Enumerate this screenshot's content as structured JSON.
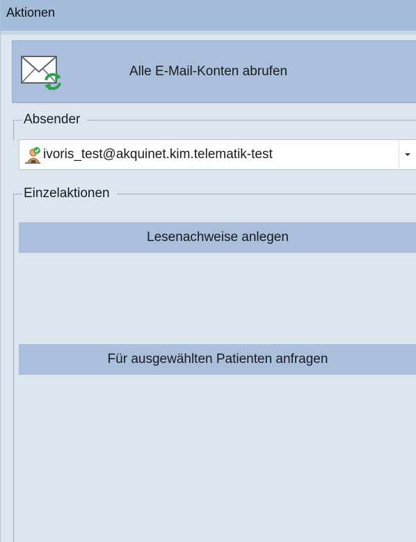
{
  "panel": {
    "title": "Aktionen"
  },
  "fetch_button": {
    "label": "Alle E-Mail-Konten abrufen",
    "icon": "mail-refresh-icon"
  },
  "sender_group": {
    "legend": "Absender",
    "selected_value": "ivoris_test@akquinet.kim.telematik-test",
    "icon": "user-connected-icon"
  },
  "single_actions_group": {
    "legend": "Einzelaktionen",
    "buttons": [
      {
        "label": "Lesenachweise anlegen"
      },
      {
        "label": "Für ausgewählten Patienten anfragen"
      }
    ]
  },
  "colors": {
    "header_bg": "#a3bcd9",
    "panel_bg": "#dde6ef",
    "button_bg": "#a9bfdb",
    "refresh_green": "#2e9e4f"
  }
}
